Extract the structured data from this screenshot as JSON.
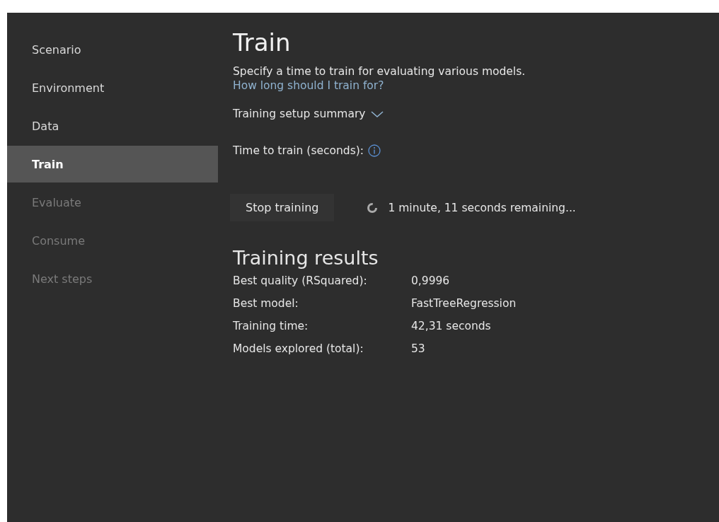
{
  "sidebar": {
    "items": [
      {
        "label": "Scenario",
        "selected": false,
        "disabled": false
      },
      {
        "label": "Environment",
        "selected": false,
        "disabled": false
      },
      {
        "label": "Data",
        "selected": false,
        "disabled": false
      },
      {
        "label": "Train",
        "selected": true,
        "disabled": false
      },
      {
        "label": "Evaluate",
        "selected": false,
        "disabled": true
      },
      {
        "label": "Consume",
        "selected": false,
        "disabled": true
      },
      {
        "label": "Next steps",
        "selected": false,
        "disabled": true
      }
    ]
  },
  "main": {
    "title": "Train",
    "description": "Specify a time to train for evaluating various models.",
    "help_link": "How long should I train for?",
    "setup_summary": {
      "label": "Training setup summary",
      "expanded": false
    },
    "time_to_train": {
      "label": "Time to train (seconds):"
    },
    "stop_button": "Stop training",
    "status": "1 minute, 11 seconds remaining...",
    "results": {
      "title": "Training results",
      "rows": [
        {
          "label": "Best quality (RSquared):",
          "value": "0,9996"
        },
        {
          "label": "Best model:",
          "value": "FastTreeRegression"
        },
        {
          "label": "Training time:",
          "value": "42,31 seconds"
        },
        {
          "label": "Models explored (total):",
          "value": "53"
        }
      ]
    }
  }
}
